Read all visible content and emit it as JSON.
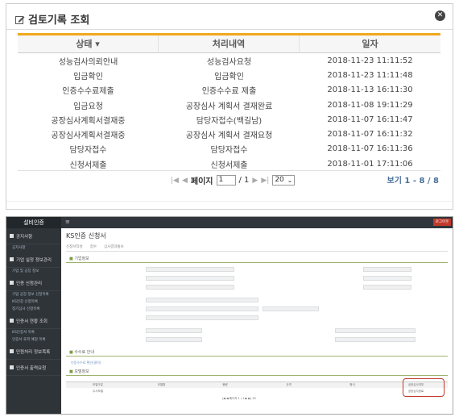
{
  "modal": {
    "title": "검토기록 조회",
    "close_icon": "close-icon",
    "columns": [
      "상태 ▾",
      "처리내역",
      "일자"
    ],
    "rows": [
      [
        "성능검사의뢰안내",
        "성능검사요청",
        "2018-11-23 11:11:52"
      ],
      [
        "입금확인",
        "입금확인",
        "2018-11-23 11:11:48"
      ],
      [
        "인증수수료제출",
        "인증수수료 제출",
        "2018-11-13 16:11:30"
      ],
      [
        "입금요청",
        "공장심사 계획서 결재완료",
        "2018-11-08 19:11:29"
      ],
      [
        "공장심사계획서결재중",
        "담당자접수(백길남)",
        "2018-11-07 16:11:47"
      ],
      [
        "공장심사계획서결재중",
        "공장심사 계획서 결재요청",
        "2018-11-07 16:11:32"
      ],
      [
        "담당자접수",
        "담당자접수",
        "2018-11-07 16:11:36"
      ],
      [
        "신청서제출",
        "신청서제출",
        "2018-11-01 17:11:06"
      ]
    ],
    "pager": {
      "first": "|◀",
      "prev": "◀",
      "page_label": "페이지",
      "page_value": "1",
      "total_pages": "/ 1",
      "next": "▶",
      "last": "▶|",
      "page_size": "20",
      "info": "보기 1 - 8 / 8"
    }
  },
  "app": {
    "brand": "설비인증",
    "topbar_menu": "≡",
    "topbar_logout": "로그아웃",
    "sidebar": [
      {
        "label": "공지사항",
        "subs": [
          "공지사항"
        ]
      },
      {
        "label": "기업 실정 정보관리",
        "subs": [
          "기업 및 공장 정보"
        ]
      },
      {
        "label": "인증 신청관리",
        "subs": [
          "기업 공장 정보 신청목록",
          "KS인증 신청목록",
          "정기심사 신청목록"
        ]
      },
      {
        "label": "인증서 현황 조회",
        "subs": [
          "KS인증서 목록",
          "인증서 효력 예정 목록"
        ]
      },
      {
        "label": "민원처리 정보목록",
        "subs": []
      },
      {
        "label": "인증서 출력요청",
        "subs": []
      }
    ],
    "page_title": "KS인증 신청서",
    "tabs": [
      "신청서작성",
      "접수",
      "심사결과통보"
    ],
    "sections": {
      "company": "기업정보",
      "fee": "수수료 안내",
      "product": "모델정보"
    },
    "fee_link": "인증수수료 확인(클릭)",
    "product_columns": [
      "모델구분",
      "모델명",
      "용량",
      "규격",
      "형식",
      "공장심사여부"
    ],
    "product_row": [
      "주사모델",
      "",
      "",
      "",
      "",
      "공장심사완료"
    ],
    "mini_pager": "|◀ ◀ 페이지 1 / 1 ▶ ▶| 20"
  }
}
